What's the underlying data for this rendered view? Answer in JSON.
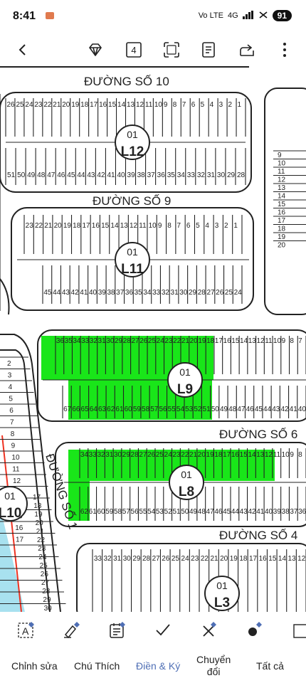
{
  "status": {
    "time": "8:41",
    "network_label": "Vo LTE",
    "signal_label": "4G",
    "battery": "91"
  },
  "toolbar": {
    "page_number": "4"
  },
  "map": {
    "roads": {
      "road10": "ĐƯỜNG SỐ 10",
      "road9": "ĐƯỜNG SỐ 9",
      "road6": "ĐƯỜNG SỐ 6",
      "road4": "ĐƯỜNG SỐ 4",
      "road1": "ĐƯỜNG SỐ 1"
    },
    "blocks": [
      {
        "num": "01",
        "code": "L12"
      },
      {
        "num": "01",
        "code": "L11"
      },
      {
        "num": "01",
        "code": "L9"
      },
      {
        "num": "01",
        "code": "L8"
      },
      {
        "num": "01",
        "code": "L10"
      },
      {
        "num": "01",
        "code": "L3"
      }
    ],
    "highlight_color": "#19e619"
  },
  "bottom_tabs": [
    {
      "label": "Chỉnh sửa"
    },
    {
      "label": "Chú Thích"
    },
    {
      "label": "Điền & Ký"
    },
    {
      "label": "Chuyển",
      "label2": "đổi"
    },
    {
      "label": "Tất cả"
    }
  ]
}
